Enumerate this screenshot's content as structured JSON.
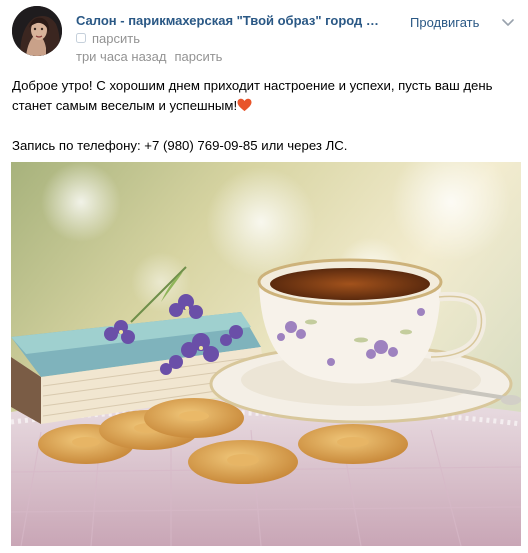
{
  "post": {
    "author": "Салон - парикмахерская \"Твой образ\" город Ор...",
    "promote_label": "Продвигать",
    "sub_tag": "парсить",
    "time": "три часа назад",
    "time_action": "парсить",
    "text_line1": "Доброе утро! С хорошим днем приходит настроение и успехи, пусть ваш день станет самым веселым и успешным!",
    "text_line2": "Запись по телефону: +7 (980) 769-09-85 или через ЛС."
  },
  "colors": {
    "link": "#2a5885",
    "muted": "#939393",
    "heart": "#e8542a"
  },
  "icons": [
    "chevron-down-icon",
    "ad-icon",
    "heart-emoji-icon"
  ]
}
